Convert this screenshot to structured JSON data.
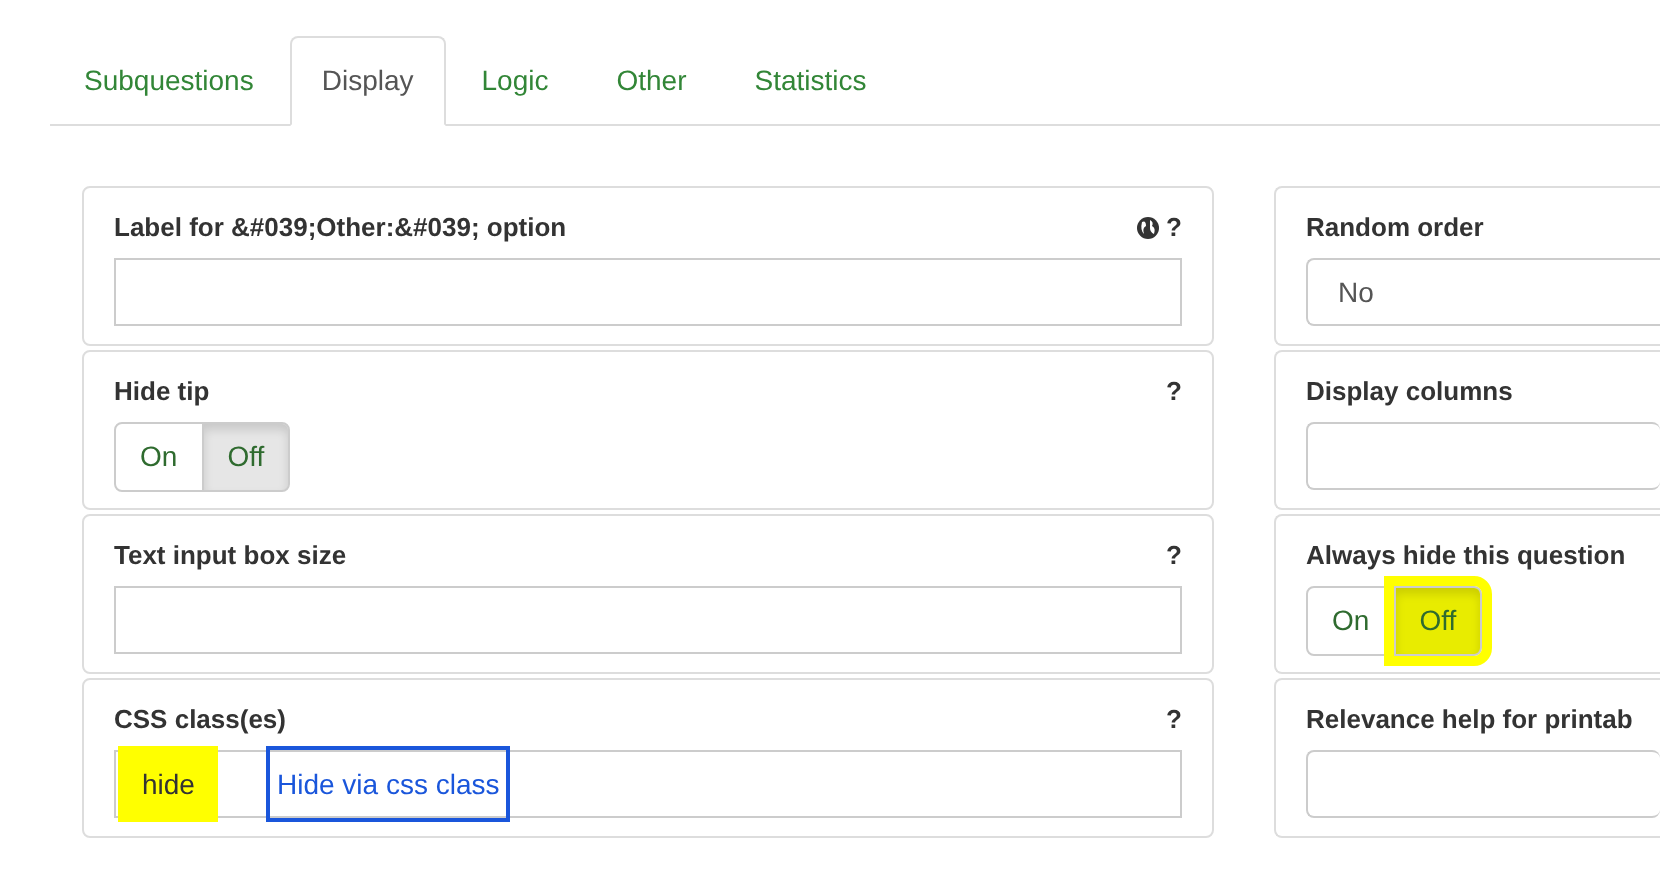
{
  "tabs": [
    {
      "label": "Subquestions",
      "selected": false
    },
    {
      "label": "Display",
      "selected": true
    },
    {
      "label": "Logic",
      "selected": false
    },
    {
      "label": "Other",
      "selected": false
    },
    {
      "label": "Statistics",
      "selected": false
    }
  ],
  "left_column": [
    {
      "kind": "text",
      "label": "Label for &#039;Other:&#039; option",
      "globe_icon": true,
      "help": "?"
    },
    {
      "kind": "toggle",
      "label": "Hide tip",
      "help": "?",
      "options": [
        {
          "label": "On",
          "selected": false,
          "highlighted": false
        },
        {
          "label": "Off",
          "selected": true,
          "highlighted": false
        }
      ]
    },
    {
      "kind": "text",
      "label": "Text input box size",
      "help": "?"
    },
    {
      "kind": "text",
      "label": "CSS class(es)",
      "help": "?",
      "value": "hide",
      "value_highlighted": true,
      "annotation": "Hide via css class"
    }
  ],
  "right_column": [
    {
      "kind": "select",
      "label": "Random order",
      "value": "No"
    },
    {
      "kind": "text",
      "label": "Display columns"
    },
    {
      "kind": "toggle",
      "label": "Always hide this question",
      "options": [
        {
          "label": "On",
          "selected": false,
          "highlighted": false
        },
        {
          "label": "Off",
          "selected": true,
          "highlighted": true
        }
      ]
    },
    {
      "kind": "text",
      "label": "Relevance help for printab"
    }
  ]
}
